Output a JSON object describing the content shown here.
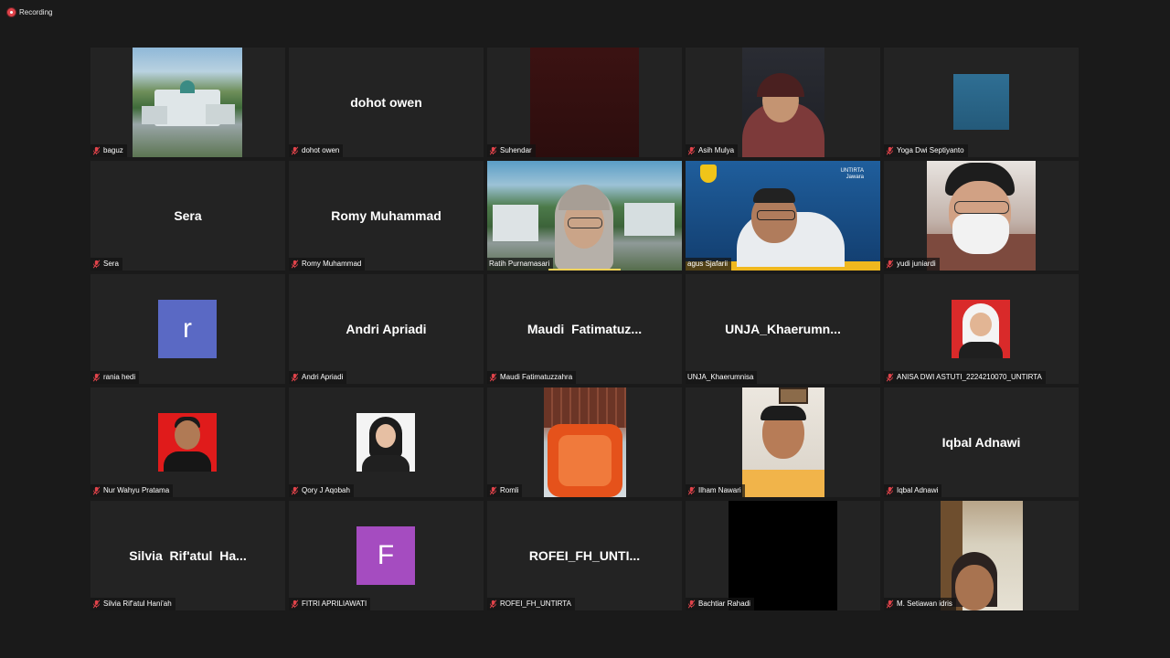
{
  "recording": {
    "label": "Recording"
  },
  "participants": [
    {
      "name": "baguz",
      "display": ""
    },
    {
      "name": "dohot owen",
      "display": "dohot owen"
    },
    {
      "name": "Suhendar",
      "display": ""
    },
    {
      "name": "Asih Mulya",
      "display": ""
    },
    {
      "name": "Yoga Dwi Septiyanto",
      "display": ""
    },
    {
      "name": "Sera",
      "display": "Sera"
    },
    {
      "name": "Romy Muhammad",
      "display": "Romy Muhammad"
    },
    {
      "name": "Ratih Purnamasari",
      "display": "",
      "unmuted": true
    },
    {
      "name": "agus Sjafarii",
      "display": "",
      "unmuted": true,
      "banner": "UNTIRTA\nJawara"
    },
    {
      "name": "yudi juniardi",
      "display": ""
    },
    {
      "name": "rania hedi",
      "display": "",
      "avatar_letter": "r",
      "avatar_color": "#5a69c4"
    },
    {
      "name": "Andri Apriadi",
      "display": "Andri Apriadi"
    },
    {
      "name": "Maudi Fatimatuzzahra",
      "display": "Maudi  Fatimatuz..."
    },
    {
      "name": "UNJA_Khaerumnisa",
      "display": "UNJA_Khaerumn...",
      "unmuted": true
    },
    {
      "name": "ANISA DWI ASTUTI_2224210070_UNTIRTA",
      "display": ""
    },
    {
      "name": "Nur Wahyu Pratama",
      "display": ""
    },
    {
      "name": "Qory J Aqobah",
      "display": ""
    },
    {
      "name": "Romli",
      "display": ""
    },
    {
      "name": "Ilham Nawari",
      "display": ""
    },
    {
      "name": "Iqbal Adnawi",
      "display": "Iqbal Adnawi"
    },
    {
      "name": "Silvia Rif'atul Hani'ah",
      "display": "Silvia  Rif'atul  Ha..."
    },
    {
      "name": "FITRI APRILIAWATI",
      "display": "",
      "avatar_letter": "F",
      "avatar_color": "#a54cc0"
    },
    {
      "name": "ROFEI_FH_UNTIRTA",
      "display": "ROFEI_FH_UNTI..."
    },
    {
      "name": "Bachtiar Rahadi",
      "display": ""
    },
    {
      "name": "M. Setiawan idris",
      "display": ""
    }
  ],
  "colors": {
    "background": "#1a1a1a",
    "tile": "#232323",
    "active_speaker_border": "#c8e36a",
    "mute_icon": "#e0434a"
  }
}
